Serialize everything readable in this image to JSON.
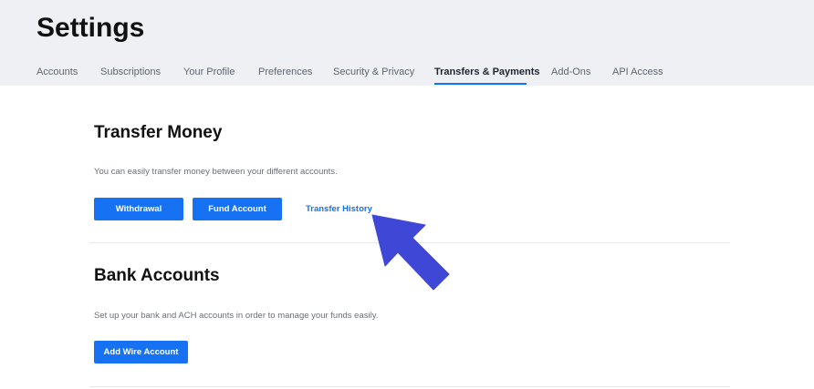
{
  "header": {
    "title": "Settings",
    "tabs": [
      {
        "label": "Accounts",
        "active": false
      },
      {
        "label": "Subscriptions",
        "active": false
      },
      {
        "label": "Your Profile",
        "active": false
      },
      {
        "label": "Preferences",
        "active": false
      },
      {
        "label": "Security & Privacy",
        "active": false
      },
      {
        "label": "Transfers & Payments",
        "active": true
      },
      {
        "label": "Add-Ons",
        "active": false
      },
      {
        "label": "API Access",
        "active": false
      }
    ]
  },
  "transfer": {
    "title": "Transfer Money",
    "description": "You can easily transfer money between your different accounts.",
    "withdrawal_label": "Withdrawal",
    "fund_label": "Fund Account",
    "history_label": "Transfer History"
  },
  "bank": {
    "title": "Bank Accounts",
    "description": "Set up your bank and ACH accounts in order to manage your funds easily.",
    "add_wire_label": "Add Wire Account"
  },
  "annotation": {
    "arrow_icon": "pointer-arrow-icon",
    "arrow_color": "#3f47d6"
  },
  "colors": {
    "accent": "#1672f3",
    "header_bg": "#eef0f3"
  }
}
